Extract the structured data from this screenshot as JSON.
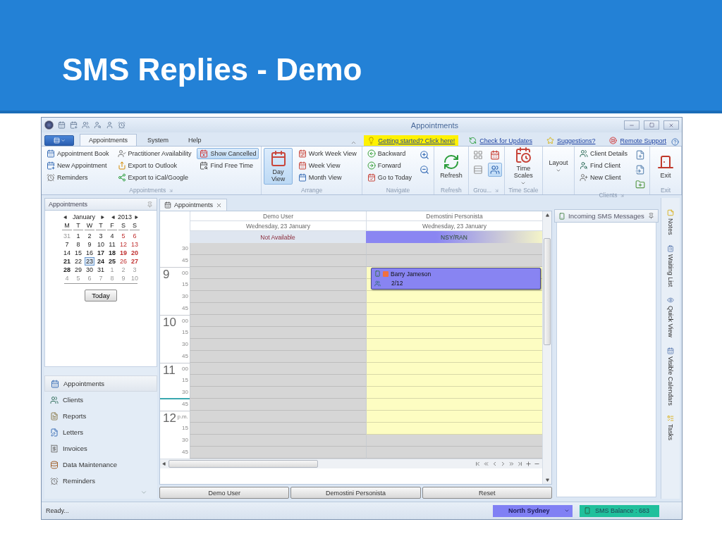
{
  "slide": {
    "title": "SMS Replies - Demo"
  },
  "window": {
    "title": "Appointments"
  },
  "ribbon": {
    "tabs": [
      {
        "label": "Appointments",
        "selected": true
      },
      {
        "label": "System",
        "selected": false
      },
      {
        "label": "Help",
        "selected": false
      }
    ],
    "links": [
      {
        "label": "Getting started? Click here!",
        "highlighted": true
      },
      {
        "label": "Check for Updates",
        "highlighted": false
      },
      {
        "label": "Suggestions?",
        "highlighted": false
      },
      {
        "label": "Remote Support",
        "highlighted": false
      }
    ],
    "groups": [
      {
        "label": "Appointments",
        "launcher": true,
        "columns": [
          [
            {
              "label": "Appointment Book",
              "kind": "small",
              "selected": false
            },
            {
              "label": "New Appointment",
              "kind": "small",
              "selected": false
            },
            {
              "label": "Reminders",
              "kind": "small",
              "selected": false
            }
          ],
          [
            {
              "label": "Practitioner Availability",
              "kind": "small",
              "selected": false
            },
            {
              "label": "Export to Outlook",
              "kind": "small",
              "selected": false
            },
            {
              "label": "Export to iCal/Google",
              "kind": "small",
              "selected": false
            }
          ],
          [
            {
              "label": "Show Cancelled",
              "kind": "small",
              "selected": true
            },
            {
              "label": "Find Free Time",
              "kind": "small",
              "selected": false
            }
          ]
        ]
      },
      {
        "label": "Arrange",
        "columns": [
          [
            {
              "label": "Day View",
              "kind": "large",
              "selected": true
            }
          ],
          [
            {
              "label": "Work Week View",
              "kind": "small",
              "selected": false
            },
            {
              "label": "Week View",
              "kind": "small",
              "selected": false
            },
            {
              "label": "Month View",
              "kind": "small",
              "selected": false
            }
          ]
        ]
      },
      {
        "label": "Navigate",
        "columns": [
          [
            {
              "label": "Backward",
              "kind": "small",
              "selected": false
            },
            {
              "label": "Forward",
              "kind": "small",
              "selected": false
            },
            {
              "label": "Go to Today",
              "kind": "small",
              "selected": false
            }
          ],
          [
            {
              "kind": "icon",
              "selected": false
            },
            {
              "kind": "icon",
              "selected": false
            }
          ]
        ]
      },
      {
        "label": "Refresh",
        "columns": [
          [
            {
              "label": "Refresh",
              "kind": "large",
              "selected": false
            }
          ]
        ]
      },
      {
        "label": "Grou...",
        "launcher": true,
        "columns": [
          [
            {
              "kind": "icon",
              "selected": false
            },
            {
              "kind": "icon",
              "selected": false
            }
          ],
          [
            {
              "kind": "icon",
              "selected": false
            },
            {
              "kind": "icon",
              "selected": true
            }
          ]
        ]
      },
      {
        "label": "Time Scale",
        "columns": [
          [
            {
              "label": "Time Scales",
              "kind": "large",
              "selected": false,
              "dropdown": true
            }
          ]
        ]
      },
      {
        "columns": [
          [
            {
              "label": "Layout",
              "kind": "large",
              "selected": false,
              "dropdown": true
            }
          ]
        ]
      },
      {
        "label": "Clients",
        "launcher": true,
        "columns": [
          [
            {
              "label": "Client Details",
              "kind": "small",
              "selected": false
            },
            {
              "label": "Find Client",
              "kind": "small",
              "selected": false
            },
            {
              "label": "New Client",
              "kind": "small",
              "selected": false
            }
          ],
          [
            {
              "kind": "icon",
              "selected": false
            },
            {
              "kind": "icon",
              "selected": false
            },
            {
              "kind": "icon",
              "selected": false
            }
          ]
        ]
      },
      {
        "label": "Exit",
        "columns": [
          [
            {
              "label": "Exit",
              "kind": "large",
              "selected": false
            }
          ]
        ]
      }
    ]
  },
  "left_pane": {
    "title": "Appointments",
    "calendar": {
      "month": "January",
      "year": "2013",
      "weekdays": [
        "M",
        "T",
        "W",
        "T",
        "F",
        "S",
        "S"
      ],
      "weeks": [
        [
          {
            "day": "31",
            "muted": true,
            "bold": false,
            "selected": false
          },
          {
            "day": "1",
            "muted": false,
            "bold": false,
            "selected": false
          },
          {
            "day": "2",
            "muted": false,
            "bold": false,
            "selected": false
          },
          {
            "day": "3",
            "muted": false,
            "bold": false,
            "selected": false
          },
          {
            "day": "4",
            "muted": false,
            "bold": false,
            "selected": false
          },
          {
            "day": "5",
            "muted": false,
            "bold": false,
            "selected": false
          },
          {
            "day": "6",
            "muted": false,
            "bold": false,
            "selected": false
          }
        ],
        [
          {
            "day": "7",
            "muted": false,
            "bold": false,
            "selected": false
          },
          {
            "day": "8",
            "muted": false,
            "bold": false,
            "selected": false
          },
          {
            "day": "9",
            "muted": false,
            "bold": false,
            "selected": false
          },
          {
            "day": "10",
            "muted": false,
            "bold": false,
            "selected": false
          },
          {
            "day": "11",
            "muted": false,
            "bold": false,
            "selected": false
          },
          {
            "day": "12",
            "muted": false,
            "bold": false,
            "selected": false
          },
          {
            "day": "13",
            "muted": false,
            "bold": false,
            "selected": false
          }
        ],
        [
          {
            "day": "14",
            "muted": false,
            "bold": false,
            "selected": false
          },
          {
            "day": "15",
            "muted": false,
            "bold": false,
            "selected": false
          },
          {
            "day": "16",
            "muted": false,
            "bold": false,
            "selected": false
          },
          {
            "day": "17",
            "muted": false,
            "bold": true,
            "selected": false
          },
          {
            "day": "18",
            "muted": false,
            "bold": true,
            "selected": false
          },
          {
            "day": "19",
            "muted": false,
            "bold": true,
            "selected": false
          },
          {
            "day": "20",
            "muted": false,
            "bold": true,
            "selected": false
          }
        ],
        [
          {
            "day": "21",
            "muted": false,
            "bold": true,
            "selected": false
          },
          {
            "day": "22",
            "muted": false,
            "bold": false,
            "selected": false
          },
          {
            "day": "23",
            "muted": false,
            "bold": false,
            "selected": true
          },
          {
            "day": "24",
            "muted": false,
            "bold": true,
            "selected": false
          },
          {
            "day": "25",
            "muted": false,
            "bold": true,
            "selected": false
          },
          {
            "day": "26",
            "muted": false,
            "bold": false,
            "selected": false
          },
          {
            "day": "27",
            "muted": false,
            "bold": true,
            "selected": false
          }
        ],
        [
          {
            "day": "28",
            "muted": false,
            "bold": true,
            "selected": false
          },
          {
            "day": "29",
            "muted": false,
            "bold": false,
            "selected": false
          },
          {
            "day": "30",
            "muted": false,
            "bold": false,
            "selected": false
          },
          {
            "day": "31",
            "muted": false,
            "bold": false,
            "selected": false
          },
          {
            "day": "1",
            "muted": true,
            "bold": false,
            "selected": false
          },
          {
            "day": "2",
            "muted": true,
            "bold": false,
            "selected": false
          },
          {
            "day": "3",
            "muted": true,
            "bold": false,
            "selected": false
          }
        ],
        [
          {
            "day": "4",
            "muted": true,
            "bold": false,
            "selected": false
          },
          {
            "day": "5",
            "muted": true,
            "bold": false,
            "selected": false
          },
          {
            "day": "6",
            "muted": true,
            "bold": false,
            "selected": false
          },
          {
            "day": "7",
            "muted": true,
            "bold": false,
            "selected": false
          },
          {
            "day": "8",
            "muted": true,
            "bold": false,
            "selected": false
          },
          {
            "day": "9",
            "muted": true,
            "bold": false,
            "selected": false
          },
          {
            "day": "10",
            "muted": true,
            "bold": false,
            "selected": false
          }
        ]
      ],
      "today_button": "Today"
    },
    "nav": [
      {
        "label": "Appointments",
        "selected": true
      },
      {
        "label": "Clients",
        "selected": false
      },
      {
        "label": "Reports",
        "selected": false
      },
      {
        "label": "Letters",
        "selected": false
      },
      {
        "label": "Invoices",
        "selected": false
      },
      {
        "label": "Data Maintenance",
        "selected": false
      },
      {
        "label": "Reminders",
        "selected": false
      }
    ]
  },
  "scheduler": {
    "tab": "Appointments",
    "columns": [
      {
        "resource": "Demo User",
        "date": "Wednesday, 23 January",
        "status": "Not Available",
        "available": false
      },
      {
        "resource": "Demostini Personista",
        "date": "Wednesday, 23 January",
        "status": "NSY/RAN",
        "available": true
      }
    ],
    "slots": [
      {
        "minute": "30",
        "open": false
      },
      {
        "minute": "45",
        "open": false
      },
      {
        "hour": "9",
        "minute": "00",
        "open": true,
        "appointment": {
          "client": "Barry Jameson",
          "detail": "2/12"
        }
      },
      {
        "minute": "15",
        "open": true
      },
      {
        "minute": "30",
        "open": true
      },
      {
        "minute": "45",
        "open": true
      },
      {
        "hour": "10",
        "minute": "00",
        "open": true
      },
      {
        "minute": "15",
        "open": true
      },
      {
        "minute": "30",
        "open": true
      },
      {
        "minute": "45",
        "open": true
      },
      {
        "hour": "11",
        "minute": "00",
        "open": true
      },
      {
        "minute": "15",
        "open": true
      },
      {
        "minute": "30",
        "open": true
      },
      {
        "minute": "45",
        "now": true,
        "open": true
      },
      {
        "hour": "12",
        "minute": "p.m.",
        "open": true
      },
      {
        "minute": "15",
        "open": true
      },
      {
        "minute": "30",
        "open": false
      },
      {
        "minute": "45",
        "open": false
      }
    ],
    "buttons": [
      "Demo User",
      "Demostini Personista",
      "Reset"
    ]
  },
  "sms_panel": {
    "title": "Incoming SMS Messages"
  },
  "side_tabs": [
    "Notes",
    "Waiting List",
    "Quick View",
    "Visible Calendars",
    "Tasks"
  ],
  "status_bar": {
    "text": "Ready...",
    "location": "North Sydney",
    "balance": "SMS Balance : 683"
  }
}
